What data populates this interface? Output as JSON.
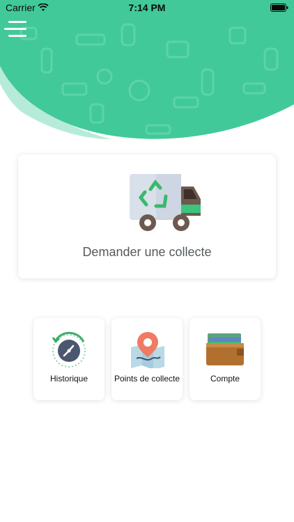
{
  "status_bar": {
    "carrier": "Carrier",
    "time": "7:14 PM"
  },
  "header": {
    "menu_icon": "hamburger-menu-icon",
    "brand_color": "#42c999",
    "pattern_icons": "recycling-items-pattern"
  },
  "main_action": {
    "label": "Demander une collecte",
    "icon": "recycling-truck-icon"
  },
  "shortcuts": [
    {
      "label": "Historique",
      "icon": "history-clock-icon"
    },
    {
      "label": "Points de collecte",
      "icon": "map-location-icon"
    },
    {
      "label": "Compte",
      "icon": "wallet-icon"
    }
  ]
}
